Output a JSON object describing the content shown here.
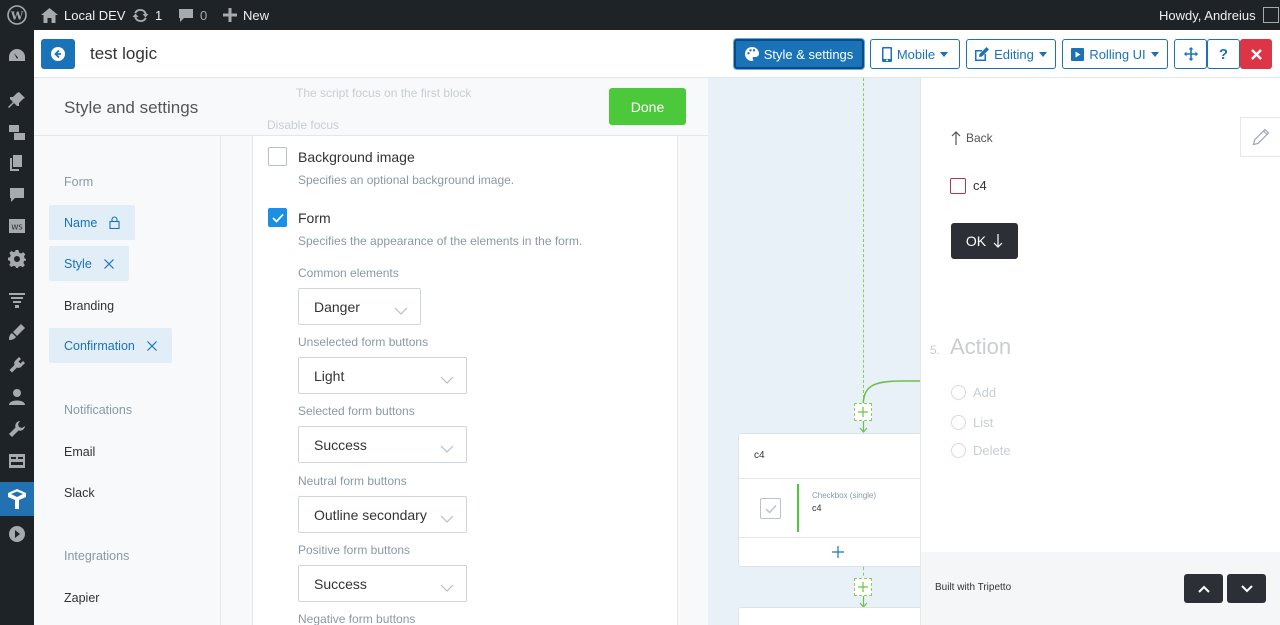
{
  "admin_bar": {
    "site_name": "Local DEV",
    "updates_count": "1",
    "comments_count": "0",
    "new_label": "New",
    "howdy": "Howdy, Andreius"
  },
  "header": {
    "form_title": "test logic",
    "style_settings_label": "Style & settings",
    "mobile_label": "Mobile",
    "editing_label": "Editing",
    "rolling_label": "Rolling UI"
  },
  "settings": {
    "title": "Style and settings",
    "done_label": "Done",
    "ghost_line1": "The script focus on the first block",
    "ghost_line2": "Disable focus",
    "nav": {
      "section_form": "Form",
      "name": "Name",
      "style": "Style",
      "branding": "Branding",
      "confirmation": "Confirmation",
      "section_notifications": "Notifications",
      "email": "Email",
      "slack": "Slack",
      "section_integrations": "Integrations",
      "zapier": "Zapier"
    },
    "background_image": {
      "label": "Background image",
      "desc": "Specifies an optional background image."
    },
    "form_section": {
      "label": "Form",
      "desc": "Specifies the appearance of the elements in the form."
    },
    "fields": [
      {
        "label": "Common elements",
        "value": "Danger"
      },
      {
        "label": "Unselected form buttons",
        "value": "Light"
      },
      {
        "label": "Selected form buttons",
        "value": "Success"
      },
      {
        "label": "Neutral form buttons",
        "value": "Outline secondary"
      },
      {
        "label": "Positive form buttons",
        "value": "Success"
      },
      {
        "label": "Negative form buttons"
      }
    ]
  },
  "map": {
    "block_title": "c4",
    "block_type": "Checkbox (single)",
    "block_name": "c4"
  },
  "preview": {
    "back_label": "Back",
    "checkbox_label": "c4",
    "ok_label": "OK",
    "action_number": "5.",
    "action_title": "Action",
    "options": [
      "Add",
      "List",
      "Delete"
    ],
    "built_with": "Built with Tripetto"
  },
  "colors": {
    "primary": "#1a73b8",
    "done": "#4cc93a",
    "danger": "#dc3545",
    "admin_bar": "#1d2327"
  }
}
